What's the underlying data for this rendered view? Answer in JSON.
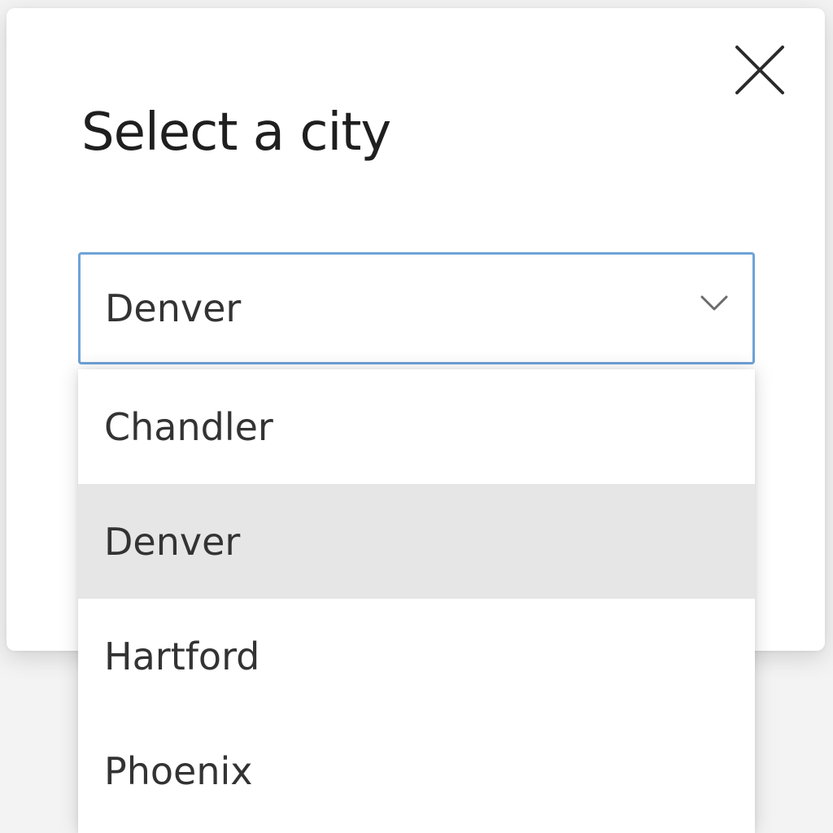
{
  "dialog": {
    "title": "Select a city",
    "close_icon": "close-icon"
  },
  "combobox": {
    "selected_value": "Denver",
    "chevron_icon": "chevron-down-icon",
    "focus_color": "#6fa3d8"
  },
  "options": [
    {
      "label": "Chandler",
      "selected": false
    },
    {
      "label": "Denver",
      "selected": true
    },
    {
      "label": "Hartford",
      "selected": false
    },
    {
      "label": "Phoenix",
      "selected": false
    }
  ],
  "colors": {
    "selected_option_bg": "#e6e6e6",
    "text": "#333333"
  }
}
